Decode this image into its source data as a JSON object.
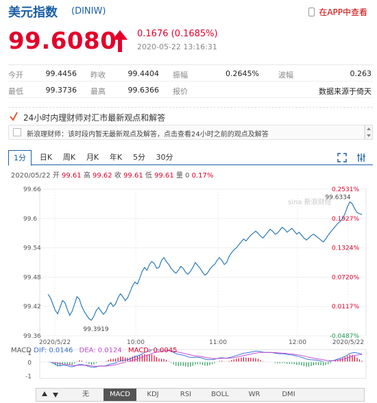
{
  "header": {
    "title": "美元指数",
    "code": "(DINIW)",
    "app_link": "在APP中查看"
  },
  "quote": {
    "price": "99.6080",
    "change": "0.1676 (0.1685%)",
    "time": "2020-05-22 13:16:31",
    "direction": "up"
  },
  "stats": {
    "rows": [
      [
        {
          "label": "今开",
          "value": "99.4456"
        },
        {
          "label": "昨收",
          "value": "99.4404"
        },
        {
          "label": "振幅",
          "value": "0.2645%"
        },
        {
          "label": "波幅",
          "value": "0.263"
        }
      ],
      [
        {
          "label": "最低",
          "value": "99.3736"
        },
        {
          "label": "最高",
          "value": "99.6366"
        },
        {
          "label": "报价",
          "value": "数据来源于倚天"
        }
      ]
    ]
  },
  "news": {
    "title": "24小时内理财师对汇市最新观点和解答",
    "text": "新浪理财师：该时段内暂无最新观点及解答，点击查看24小时之前的观点及解答"
  },
  "tabs": [
    "1分",
    "日K",
    "周K",
    "月K",
    "年K",
    "5分",
    "30分"
  ],
  "active_tab": "1分",
  "ohlc": {
    "date": "2020/05/22",
    "open_label": "开",
    "open": "99.61",
    "high_label": "高",
    "high": "99.62",
    "close_label": "收",
    "close": "99.61",
    "low_label": "低",
    "low": "99.61",
    "volume_label": "量",
    "volume": "0",
    "pct": "0.17%"
  },
  "watermark": "sina 新浪财经",
  "chart_data": {
    "type": "line",
    "y_ticks": [
      "99.66",
      "99.6",
      "99.54",
      "99.48",
      "99.42",
      "99.36"
    ],
    "y_ticks_right": [
      "0.2531%",
      "0.1927%",
      "0.1324%",
      "0.0720%",
      "0.0117%",
      "-0.0487%"
    ],
    "x_ticks": [
      "2020/5/22",
      "10:00",
      "11:00",
      "12:00",
      "2020/5/22"
    ],
    "ylim": [
      99.36,
      99.66
    ],
    "max_label": "99.6334",
    "min_label": "99.3919",
    "series": [
      {
        "values": [
          99.445,
          99.438,
          99.425,
          99.412,
          99.405,
          99.418,
          99.432,
          99.428,
          99.414,
          99.402,
          99.41,
          99.425,
          99.44,
          99.435,
          99.42,
          99.41,
          99.402,
          99.395,
          99.392,
          99.4,
          99.412,
          99.418,
          99.41,
          99.404,
          99.41,
          99.422,
          99.428,
          99.42,
          99.425,
          99.438,
          99.446,
          99.44,
          99.432,
          99.438,
          99.45,
          99.462,
          99.47,
          99.466,
          99.478,
          99.492,
          99.5,
          99.494,
          99.506,
          99.512,
          99.508,
          99.498,
          99.5,
          99.514,
          99.52,
          99.512,
          99.506,
          99.498,
          99.492,
          99.488,
          99.494,
          99.502,
          99.498,
          99.49,
          99.486,
          99.492,
          99.5,
          99.51,
          99.504,
          99.498,
          99.49,
          99.484,
          99.488,
          99.496,
          99.502,
          99.506,
          99.514,
          99.52,
          99.514,
          99.506,
          99.51,
          99.522,
          99.53,
          99.536,
          99.54,
          99.546,
          99.552,
          99.558,
          99.554,
          99.56,
          99.566,
          99.57,
          99.574,
          99.57,
          99.564,
          99.56,
          99.566,
          99.572,
          99.578,
          99.574,
          99.568,
          99.57,
          99.576,
          99.582,
          99.578,
          99.572,
          99.576,
          99.58,
          99.574,
          99.568,
          99.572,
          99.566,
          99.56,
          99.556,
          99.56,
          99.565,
          99.568,
          99.564,
          99.56,
          99.556,
          99.552,
          99.558,
          99.566,
          99.572,
          99.578,
          99.584,
          99.59,
          99.594,
          99.6,
          99.61,
          99.624,
          99.634,
          99.63,
          99.62,
          99.612,
          99.61,
          99.608
        ]
      }
    ]
  },
  "macd": {
    "label": "MACD",
    "dif_label": "DIF: 0.0146",
    "dea_label": "DEA: 0.0124",
    "macd_label": "MACD: 0.0045",
    "y_ticks": [
      "1",
      "0",
      "-1"
    ]
  },
  "indicator_tabs": [
    "无",
    "MACD",
    "KDJ",
    "RSI",
    "BOLL",
    "WR",
    "DMI"
  ],
  "active_indicator": "MACD",
  "colors": {
    "accent": "#1a5fa6",
    "up": "#e4002b",
    "down": "#1c9b53",
    "line": "#2a7ab6",
    "dif": "#3a6fd8",
    "dea": "#c04fd0"
  }
}
